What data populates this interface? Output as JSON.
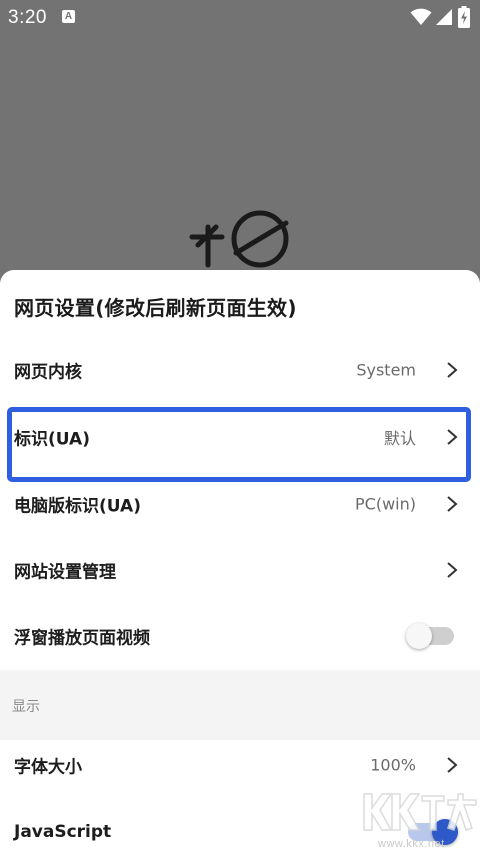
{
  "status_bar": {
    "time": "3:20",
    "notif_letter": "A"
  },
  "sheet": {
    "title": "网页设置(修改后刷新页面生效)",
    "rows": [
      {
        "label": "网页内核",
        "value": "System",
        "type": "chevron"
      },
      {
        "label": "标识(UA)",
        "value": "默认",
        "type": "chevron"
      },
      {
        "label": "电脑版标识(UA)",
        "value": "PC(win)",
        "type": "chevron"
      },
      {
        "label": "网站设置管理",
        "value": "",
        "type": "chevron"
      },
      {
        "label": "浮窗播放页面视频",
        "value": "",
        "type": "toggle",
        "on": false
      }
    ],
    "section": {
      "label": "显示"
    },
    "display_rows": [
      {
        "label": "字体大小",
        "value": "100%",
        "type": "chevron"
      },
      {
        "label": "JavaScript",
        "value": "",
        "type": "toggle",
        "on": true
      }
    ]
  },
  "watermark": {
    "logo": "KK下载",
    "text": "www.kkx.net"
  },
  "colors": {
    "highlight": "#2f5fe0",
    "accent": "#2e59c8",
    "overlay": "#737373"
  }
}
